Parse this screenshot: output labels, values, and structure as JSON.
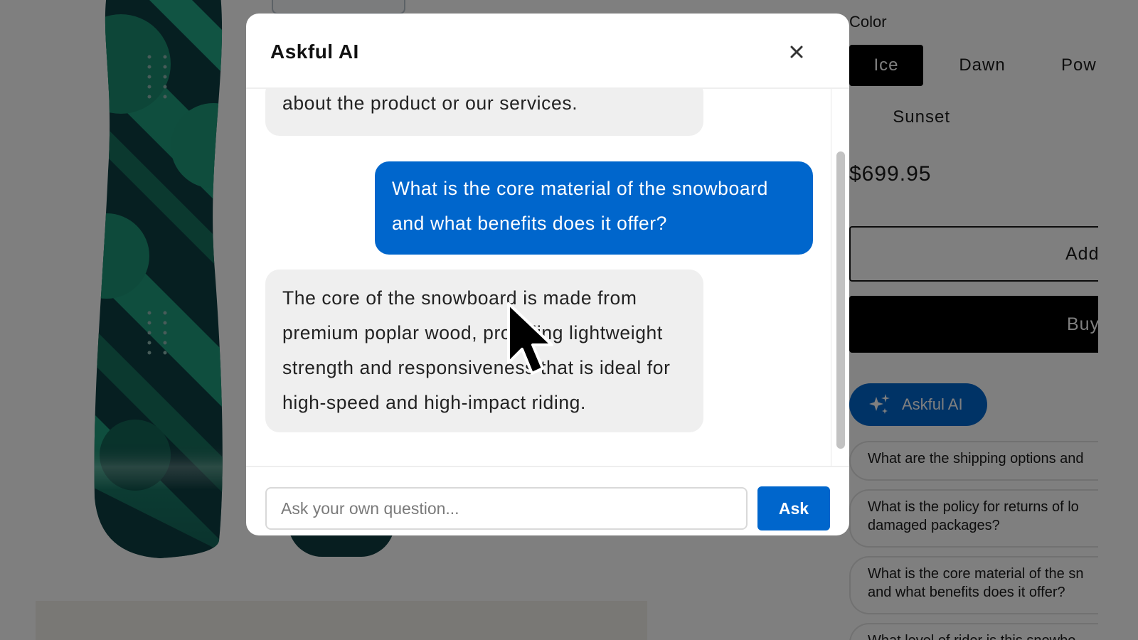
{
  "product": {
    "color_label": "Color",
    "colors": [
      "Ice",
      "Dawn",
      "Pow",
      "Sunset"
    ],
    "selected_color": "Ice",
    "price": "$699.95",
    "add_label": "Add",
    "buy_label": "Buy",
    "ai_button_label": "Askful AI",
    "suggestions": [
      "What are the shipping options and",
      "What is the policy for returns of lo\ndamaged packages?",
      "What is the core material of the sn\nand what benefits does it offer?",
      "What level of rider is this snowbo"
    ]
  },
  "modal": {
    "title": "Askful AI",
    "messages": [
      {
        "role": "assistant",
        "text": "about the product or our services."
      },
      {
        "role": "user",
        "text": "What is the core material of the snowboard and what benefits does it offer?"
      },
      {
        "role": "assistant",
        "text": "The core of the snowboard is made from premium poplar wood, providing lightweight strength and responsiveness that is ideal for high-speed and high-impact riding."
      }
    ],
    "input_placeholder": "Ask your own question...",
    "ask_label": "Ask"
  },
  "colors": {
    "accent": "#0066cc",
    "bot_bubble": "#efefef",
    "overlay": "rgba(0,0,0,0.5)",
    "board_teal": "#1f9c7c",
    "board_dark": "#0d3f42"
  }
}
